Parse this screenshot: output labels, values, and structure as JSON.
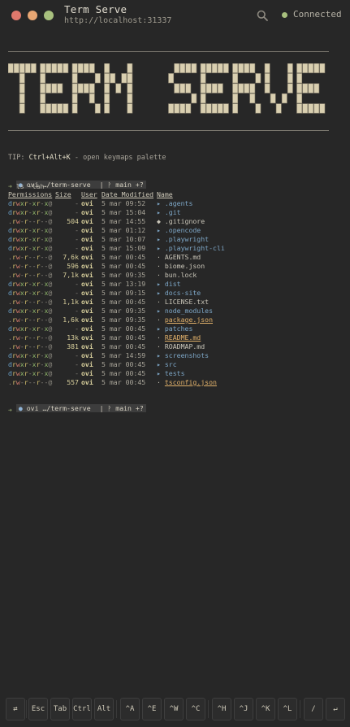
{
  "window": {
    "title": "Term Serve",
    "url": "http://localhost:31337",
    "status": "Connected",
    "traffic_lights": [
      "#e0786c",
      "#e8a673",
      "#a8c07e"
    ],
    "status_color": "#a8c07e"
  },
  "banner": {
    "text": "TERM SERVE"
  },
  "tip": {
    "prefix": "TIP: ",
    "shortcut": "Ctrl+Alt+K",
    "suffix": " - open keymaps palette"
  },
  "prompt1": {
    "os_icon": "apple-icon",
    "user": "ovi",
    "path": "…/term-serve",
    "branch": "| ᚹ main",
    "git_status": "+?"
  },
  "command": {
    "arrow": "➜",
    "text": "ls -lah"
  },
  "listing": {
    "headers": [
      "Permissions",
      "Size",
      "User",
      "Date Modified",
      "Name"
    ],
    "rows": [
      {
        "perm": "drwxr-xr-x@",
        "size": "-",
        "user": "ovi",
        "date": "5 mar 09:52",
        "icon": "▸",
        "name": ".agents",
        "kind": "dir"
      },
      {
        "perm": "drwxr-xr-x@",
        "size": "-",
        "user": "ovi",
        "date": "5 mar 15:04",
        "icon": "▸",
        "name": ".git",
        "kind": "dir"
      },
      {
        "perm": ".rw-r--r--@",
        "size": "504",
        "user": "ovi",
        "date": "5 mar 14:55",
        "icon": "◆",
        "name": ".gitignore",
        "kind": "file"
      },
      {
        "perm": "drwxr-xr-x@",
        "size": "-",
        "user": "ovi",
        "date": "5 mar 01:12",
        "icon": "▸",
        "name": ".opencode",
        "kind": "dir"
      },
      {
        "perm": "drwxr-xr-x@",
        "size": "-",
        "user": "ovi",
        "date": "5 mar 10:07",
        "icon": "▸",
        "name": ".playwright",
        "kind": "dir"
      },
      {
        "perm": "drwxr-xr-x@",
        "size": "-",
        "user": "ovi",
        "date": "5 mar 15:09",
        "icon": "▸",
        "name": ".playwright-cli",
        "kind": "dir"
      },
      {
        "perm": ".rw-r--r--@",
        "size": "7,6k",
        "user": "ovi",
        "date": "5 mar 00:45",
        "icon": "·",
        "name": "AGENTS.md",
        "kind": "file"
      },
      {
        "perm": ".rw-r--r--@",
        "size": "596",
        "user": "ovi",
        "date": "5 mar 00:45",
        "icon": "·",
        "name": "biome.json",
        "kind": "file"
      },
      {
        "perm": ".rw-r--r--@",
        "size": "7,1k",
        "user": "ovi",
        "date": "5 mar 09:35",
        "icon": "·",
        "name": "bun.lock",
        "kind": "file"
      },
      {
        "perm": "drwxr-xr-x@",
        "size": "-",
        "user": "ovi",
        "date": "5 mar 13:19",
        "icon": "▸",
        "name": "dist",
        "kind": "dir"
      },
      {
        "perm": "drwxr-xr-x@",
        "size": "-",
        "user": "ovi",
        "date": "5 mar 09:15",
        "icon": "▸",
        "name": "docs-site",
        "kind": "dir"
      },
      {
        "perm": ".rw-r--r--@",
        "size": "1,1k",
        "user": "ovi",
        "date": "5 mar 00:45",
        "icon": "·",
        "name": "LICENSE.txt",
        "kind": "file"
      },
      {
        "perm": "drwxr-xr-x@",
        "size": "-",
        "user": "ovi",
        "date": "5 mar 09:35",
        "icon": "▸",
        "name": "node_modules",
        "kind": "dir"
      },
      {
        "perm": ".rw-r--r--@",
        "size": "1,6k",
        "user": "ovi",
        "date": "5 mar 09:35",
        "icon": "·",
        "name": "package.json",
        "kind": "cfg"
      },
      {
        "perm": "drwxr-xr-x@",
        "size": "-",
        "user": "ovi",
        "date": "5 mar 00:45",
        "icon": "▸",
        "name": "patches",
        "kind": "dir"
      },
      {
        "perm": ".rw-r--r--@",
        "size": "13k",
        "user": "ovi",
        "date": "5 mar 00:45",
        "icon": "·",
        "name": "README.md",
        "kind": "cfg"
      },
      {
        "perm": ".rw-r--r--@",
        "size": "381",
        "user": "ovi",
        "date": "5 mar 00:45",
        "icon": "·",
        "name": "ROADMAP.md",
        "kind": "file"
      },
      {
        "perm": "drwxr-xr-x@",
        "size": "-",
        "user": "ovi",
        "date": "5 mar 14:59",
        "icon": "▸",
        "name": "screenshots",
        "kind": "dir"
      },
      {
        "perm": "drwxr-xr-x@",
        "size": "-",
        "user": "ovi",
        "date": "5 mar 00:45",
        "icon": "▸",
        "name": "src",
        "kind": "dir"
      },
      {
        "perm": "drwxr-xr-x@",
        "size": "-",
        "user": "ovi",
        "date": "5 mar 00:45",
        "icon": "▸",
        "name": "tests",
        "kind": "dir"
      },
      {
        "perm": ".rw-r--r--@",
        "size": "557",
        "user": "ovi",
        "date": "5 mar 00:45",
        "icon": "·",
        "name": "tsconfig.json",
        "kind": "cfg"
      }
    ]
  },
  "prompt2": {
    "os_icon": "apple-icon",
    "user": "ovi",
    "path": "…/term-serve",
    "branch": "| ᚹ main",
    "git_status": "+?"
  },
  "cursor_glyph": "➜",
  "keybar": {
    "swap": "⇄",
    "keys": [
      "Esc",
      "Tab",
      "Ctrl",
      "Alt",
      "^A",
      "^E",
      "^W",
      "^C",
      "^H",
      "^J",
      "^K",
      "^L",
      "/",
      "↵"
    ]
  }
}
